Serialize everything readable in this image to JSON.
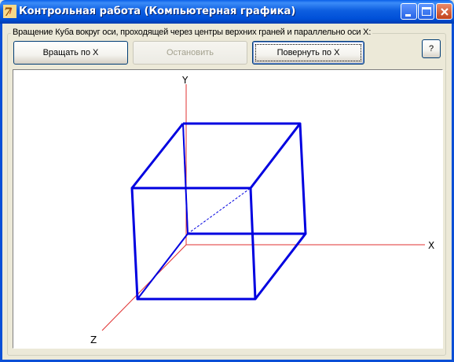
{
  "window": {
    "title": "Контрольная работа (Компьютерная графика)"
  },
  "group": {
    "title": "Вращение Куба вокруг оси, проходящей через центры верхних граней и параллельно оси X:"
  },
  "buttons": {
    "rotate_label": "Вращать по X",
    "stop_label": "Остановить",
    "turn_label": "Повернуть по X",
    "help_label": "?"
  },
  "axes": {
    "x_label": "X",
    "y_label": "Y",
    "z_label": "Z"
  },
  "colors": {
    "cube_edges": "#0000e0",
    "axes": "#e03030",
    "title_bar": "#0a5fe8"
  }
}
